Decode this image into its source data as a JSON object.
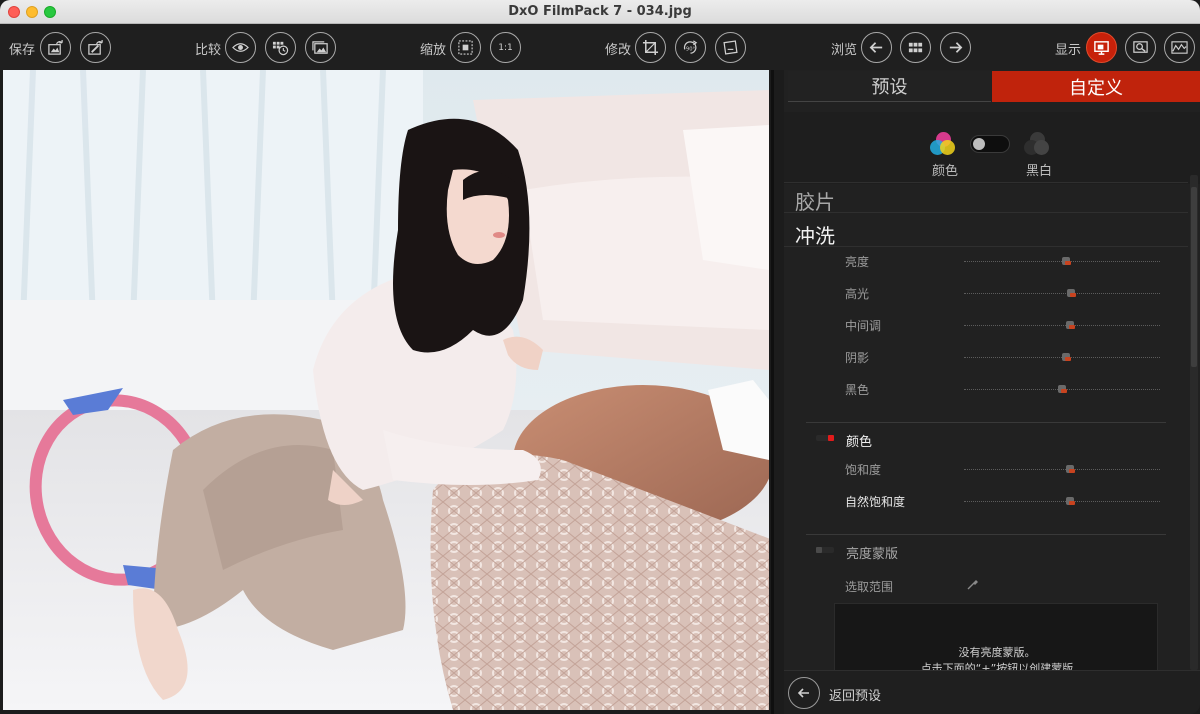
{
  "window": {
    "title": "DxO FilmPack 7 - 034.jpg"
  },
  "toolbar": {
    "save_label": "保存",
    "compare_label": "比较",
    "zoom_label": "缩放",
    "zoom_1to1": "1:1",
    "edit_label": "修改",
    "rotate_label": "90°",
    "browse_label": "浏览",
    "display_label": "显示"
  },
  "tabs": {
    "preset": "预设",
    "custom": "自定义"
  },
  "mode": {
    "color_label": "颜色",
    "bw_label": "黑白",
    "toggle_state": "color"
  },
  "sections": {
    "film_title": "胶片",
    "develop_title": "冲洗",
    "develop_sliders": [
      {
        "label": "亮度",
        "value": 0.52
      },
      {
        "label": "高光",
        "value": 0.55
      },
      {
        "label": "中间调",
        "value": 0.54
      },
      {
        "label": "阴影",
        "value": 0.52
      },
      {
        "label": "黑色",
        "value": 0.5
      }
    ],
    "color_group": {
      "label": "颜色",
      "enabled": true
    },
    "color_sliders": [
      {
        "label": "饱和度",
        "value": 0.54
      },
      {
        "label": "自然饱和度",
        "value": 0.54
      }
    ],
    "luma_mask": {
      "label": "亮度蒙版",
      "enabled": false,
      "select_range_label": "选取范围",
      "empty_line1": "没有亮度蒙版。",
      "empty_line2": "点击下面的“+”按钮以创建蒙版"
    }
  },
  "bottom": {
    "back_label": "返回预设"
  },
  "colors": {
    "accent": "#c0230c",
    "panel_bg": "#212121",
    "toolbar_bg": "#1f1f1f"
  }
}
